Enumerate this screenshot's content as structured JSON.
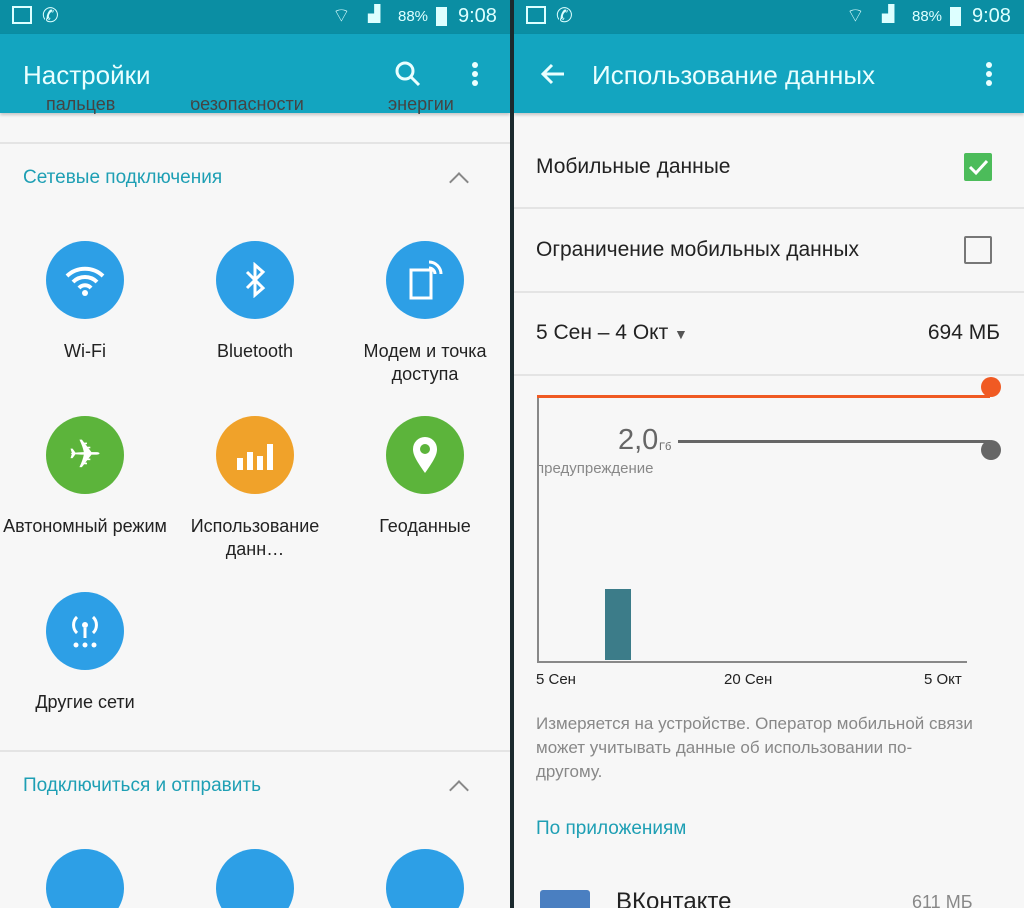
{
  "status_bar": {
    "battery": "88%",
    "time": "9:08"
  },
  "left": {
    "title": "Настройки",
    "cut_labels": [
      "пальцев",
      "безопасности",
      "энергии"
    ],
    "sections": [
      {
        "title": "Сетевые подключения",
        "items": [
          {
            "label": "Wi-Fi",
            "icon": "wifi-icon",
            "color": "#2d9fe6"
          },
          {
            "label": "Bluetooth",
            "icon": "bluetooth-icon",
            "color": "#2d9fe6"
          },
          {
            "label": "Модем и точка доступа",
            "icon": "hotspot-icon",
            "color": "#2d9fe6"
          },
          {
            "label": "Автономный режим",
            "icon": "airplane-icon",
            "color": "#5cb43b"
          },
          {
            "label": "Исполь­зование данн…",
            "icon": "data-usage-icon",
            "color": "#f0a22a"
          },
          {
            "label": "Геоданные",
            "icon": "location-icon",
            "color": "#5cb43b"
          },
          {
            "label": "Другие сети",
            "icon": "other-networks-icon",
            "color": "#2d9fe6"
          }
        ]
      },
      {
        "title": "Подключиться и отправить",
        "items": [
          {
            "icon": "nfc-icon",
            "color": "#2d9fe6"
          },
          {
            "icon": "nearby-scan-icon",
            "color": "#2d9fe6"
          },
          {
            "icon": "printer-icon",
            "color": "#2d9fe6"
          }
        ]
      }
    ]
  },
  "right": {
    "title": "Использование данных",
    "mobile_data": {
      "label": "Мобильные данные",
      "checked": true
    },
    "limit": {
      "label": "Ограничение мобильных данных",
      "checked": false
    },
    "period": "5 Сен – 4 Окт",
    "total": "694 МБ",
    "warning_value": "2,0",
    "warning_unit": "Гб",
    "warning_label": "предупреждение",
    "note": "Измеряется на устройстве. Оператор мобильной связи может учитывать данные об использовании по-другому.",
    "by_apps": "По приложениям",
    "apps": [
      {
        "name": "ВКонтакте",
        "size": "611 МБ"
      }
    ]
  },
  "chart_data": {
    "type": "bar",
    "x_ticks": [
      "5 Сен",
      "20 Сен",
      "5 Окт"
    ],
    "warning_gb": 2.0,
    "limit_color": "#f05a23",
    "bar_color": "#3c7c89",
    "bars": [
      {
        "x": "9–10 Сен",
        "note": "single usage bar"
      }
    ]
  }
}
